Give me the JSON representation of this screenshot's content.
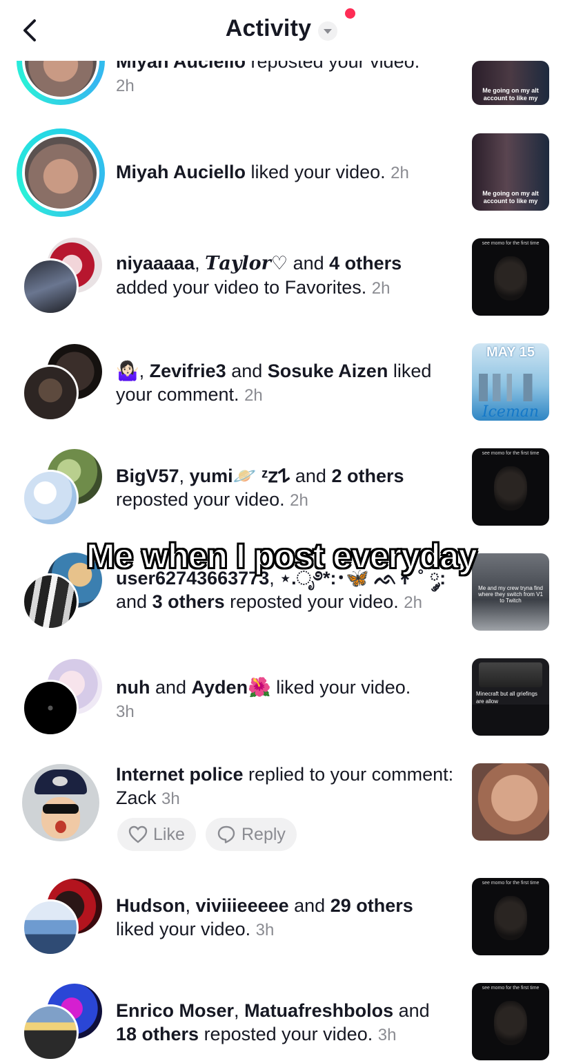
{
  "header": {
    "title": "Activity",
    "back_icon": "chevron-left-icon",
    "dropdown_icon": "caret-down-icon",
    "notification_dot_color": "#fe2c55"
  },
  "overlay_caption": "Me when I post everyday",
  "rows": [
    {
      "prefix": "Miyah Auciello",
      "action": " reposted your video.",
      "time": "2h",
      "thumb_text": "Me going on my alt account to like my"
    },
    {
      "prefix": "Miyah Auciello",
      "action": " liked your video. ",
      "time": "2h",
      "thumb_text": "Me going on my alt account to like my"
    },
    {
      "name1": "niyaaaaa",
      "sep1": ", ",
      "name2": "𝑻𝒂𝒚𝒍𝒐𝒓♡",
      "mid": " and ",
      "name3": "4 others",
      "action": "added your video to Favorites. ",
      "time": "2h",
      "thumb_text": "see momo for the first time"
    },
    {
      "name0": "🤷🏻‍♀️",
      "sep0": ", ",
      "name1": "Zevifrie3",
      "mid": " and ",
      "name2": "Sosuke Aizen",
      "action": " liked your comment. ",
      "time": "2h",
      "thumb_text": "MAY 15",
      "thumb_sub": "Iceman"
    },
    {
      "name1": "BigV57",
      "sep1": ", ",
      "name2": "yumi🪐 ᶻ𝗓𐰁",
      "mid": " and ",
      "name3": "2 others",
      "action": "reposted your video. ",
      "time": "2h",
      "thumb_text": "see momo for the first time"
    },
    {
      "name1": "user62743663773",
      "sep1": ", ",
      "name2": "⋆.ೃ࿔*:･🦋 ᨒ↟ ˚ ༘:",
      "action_pre": "and ",
      "name3": "3 others",
      "action": " reposted your video. ",
      "time": "2h",
      "thumb_text": "Me and my crew tryna find where they switch from V1 to Twitch"
    },
    {
      "name1": "nuh",
      "mid": " and ",
      "name2": "Ayden🌺",
      "action": " liked your video.",
      "time": "3h",
      "thumb_text": "Minecraft but all griefings are allow"
    },
    {
      "name1": "Internet police",
      "action": " replied to your comment: Zack ",
      "time": "3h",
      "like_label": "Like",
      "reply_label": "Reply"
    },
    {
      "name1": "Hudson",
      "sep1": ", ",
      "name2": "viviiieeeee",
      "mid": " and ",
      "name3": "29 others",
      "action": "liked your video. ",
      "time": "3h",
      "thumb_text": "see momo for the first time"
    },
    {
      "name1": "Enrico Moser",
      "sep1": ", ",
      "name2": "Matuafreshbolos",
      "mid": " and ",
      "name3": "18 others",
      "action": " reposted your video. ",
      "time": "3h",
      "thumb_text": "see momo for the first time"
    }
  ]
}
